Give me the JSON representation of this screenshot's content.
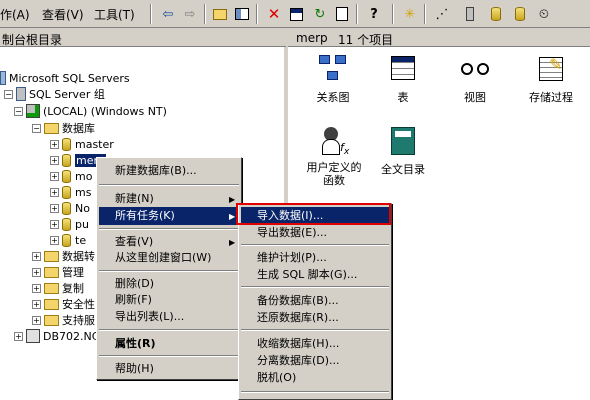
{
  "menubar": {
    "action": "作(A)",
    "view": "查看(V)",
    "tools": "工具(T)"
  },
  "left": {
    "title": "制台根目录",
    "tree": {
      "root": "Microsoft SQL Servers",
      "group": "SQL Server 组",
      "local": "(LOCAL) (Windows NT)",
      "databases": "数据库",
      "master": "master",
      "merp": "merp",
      "mo": "mo",
      "ms": "ms",
      "no": "No",
      "pu": "pu",
      "te": "te",
      "dts": "数据转",
      "mgmt": "管理",
      "repl": "复制",
      "sec": "安全性",
      "support": "支持服",
      "db702": "DB702.NC"
    }
  },
  "right": {
    "header_name": "merp",
    "header_count": "11 个项目",
    "items": [
      {
        "label": "关系图"
      },
      {
        "label": "表"
      },
      {
        "label": "视图"
      },
      {
        "label": "存储过程"
      },
      {
        "label": "用户定义的\n函数"
      },
      {
        "label": "全文目录"
      }
    ]
  },
  "ctx1": {
    "new_db": "新建数据库(B)...",
    "new": "新建(N)",
    "all_tasks": "所有任务(K)",
    "view": "查看(V)",
    "new_window": "从这里创建窗口(W)",
    "delete": "删除(D)",
    "refresh": "刷新(F)",
    "export_list": "导出列表(L)...",
    "properties": "属性(R)",
    "help": "帮助(H)"
  },
  "ctx2": {
    "import": "导入数据(I)...",
    "export": "导出数据(E)...",
    "maint": "维护计划(P)...",
    "gen_sql": "生成 SQL 脚本(G)...",
    "backup": "备份数据库(B)...",
    "restore": "还原数据库(R)...",
    "shrink": "收缩数据库(H)...",
    "detach": "分离数据库(D)...",
    "offline": "脱机(O)"
  },
  "colors": {
    "highlight": "#0a246a",
    "redbox": "#e00000"
  }
}
